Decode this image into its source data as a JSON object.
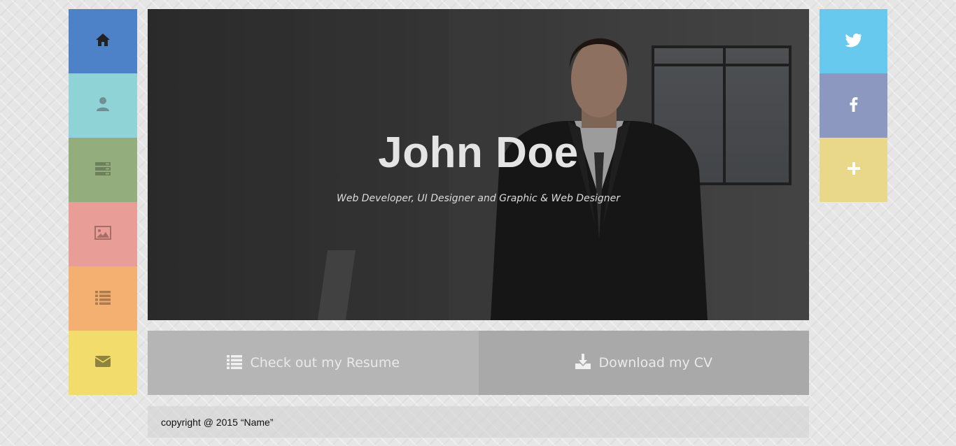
{
  "nav": {
    "items": [
      {
        "icon": "home-icon",
        "color": "#4d82c8"
      },
      {
        "icon": "user-icon",
        "color": "#8fd3d6"
      },
      {
        "icon": "server-icon",
        "color": "#94ad7c"
      },
      {
        "icon": "image-icon",
        "color": "#e89d96"
      },
      {
        "icon": "list-icon",
        "color": "#f3b071"
      },
      {
        "icon": "envelope-icon",
        "color": "#f2dc6c"
      }
    ]
  },
  "social": {
    "items": [
      {
        "icon": "twitter-icon",
        "color": "#68c9ee"
      },
      {
        "icon": "facebook-icon",
        "color": "#8c98c0"
      },
      {
        "icon": "plus-icon",
        "color": "#ead88a"
      }
    ]
  },
  "hero": {
    "name": "John Doe",
    "subtitle": "Web Developer, UI Designer and Graphic & Web Designer"
  },
  "actions": {
    "resume_label": "Check out my Resume",
    "cv_label": "Download my CV"
  },
  "footer": {
    "copyright": "copyright @ 2015 “Name”"
  }
}
